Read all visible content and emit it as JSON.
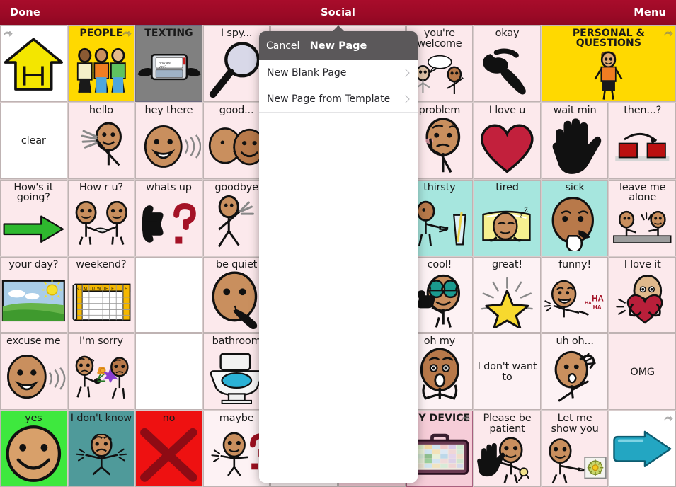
{
  "topbar": {
    "done_label": "Done",
    "title": "Social",
    "menu_label": "Menu",
    "bg_color": "#9e0b28"
  },
  "popover": {
    "cancel_label": "Cancel",
    "title": "New Page",
    "header_color": "#5b585a",
    "rows": [
      {
        "label": "New Blank Page"
      },
      {
        "label": "New Page from Template"
      }
    ]
  },
  "palette": {
    "pink": "#fce9ec",
    "pale_pink": "#fdf2f4",
    "yellow": "#ffd900",
    "gray": "#808080",
    "teal": "#a6e6de",
    "green": "#3ee83e",
    "dark_teal": "#4f9a9a",
    "red": "#ee1111",
    "white": "#ffffff",
    "arrow_teal": "#22a3bf",
    "arrow_green": "#2eb82e",
    "heart_red": "#c2203c"
  },
  "grid": {
    "columns": 10,
    "rows": 6,
    "cells": [
      {
        "id": "home",
        "label": "",
        "art": "house-icon",
        "bg": "#ffffff",
        "link": true,
        "link_side": "left",
        "category": false
      },
      {
        "id": "people",
        "label": "PEOPLE",
        "art": "people-icon",
        "bg": "#ffd900",
        "link": true,
        "category": true
      },
      {
        "id": "texting",
        "label": "TEXTING",
        "art": "texting-icon",
        "bg": "#808080",
        "link": false,
        "category": true
      },
      {
        "id": "i-spy",
        "label": "I spy...",
        "art": "magnifier-icon",
        "bg": "#fce9ec",
        "link": false,
        "category": false
      },
      {
        "id": "hidden-r1c5",
        "label": "",
        "art": "",
        "bg": "#fce9ec",
        "link": false,
        "category": false
      },
      {
        "id": "hidden-r1c6",
        "label": "",
        "art": "",
        "bg": "#fce9ec",
        "link": false,
        "category": false
      },
      {
        "id": "youre-welcome",
        "label": "you're welcome",
        "art": "two-people-talking-icon",
        "bg": "#fce9ec",
        "link": false,
        "category": false
      },
      {
        "id": "okay",
        "label": "okay",
        "art": "ok-hand-icon",
        "bg": "#fce9ec",
        "link": false,
        "category": false
      },
      {
        "id": "personal-questions",
        "label": "PERSONAL & QUESTIONS",
        "art": "boy-icon",
        "bg": "#ffd900",
        "link": true,
        "category": true,
        "span": 2
      },
      {
        "id": "clear",
        "label": "clear",
        "art": "",
        "bg": "#ffffff",
        "link": false,
        "category": false,
        "center": true
      },
      {
        "id": "hello",
        "label": "hello",
        "art": "waving-person-icon",
        "bg": "#fce9ec",
        "link": false,
        "category": false
      },
      {
        "id": "hey-there",
        "label": "hey there",
        "art": "smiling-face-speaking-icon",
        "bg": "#fce9ec",
        "link": false,
        "category": false
      },
      {
        "id": "good",
        "label": "good...",
        "art": "two-faces-icon",
        "bg": "#fce9ec",
        "link": false,
        "category": false
      },
      {
        "id": "hidden-r2c5",
        "label": "",
        "art": "",
        "bg": "#fce9ec",
        "link": false,
        "category": false
      },
      {
        "id": "hidden-r2c6",
        "label": "",
        "art": "",
        "bg": "#fce9ec",
        "link": false,
        "category": false
      },
      {
        "id": "problem",
        "label": "problem",
        "art": "worried-person-icon",
        "bg": "#fce9ec",
        "link": false,
        "category": false
      },
      {
        "id": "i-love-u",
        "label": "I love u",
        "art": "heart-icon",
        "bg": "#fce9ec",
        "link": false,
        "category": false
      },
      {
        "id": "wait-min",
        "label": "wait min",
        "art": "open-hand-icon",
        "bg": "#fce9ec",
        "link": false,
        "category": false
      },
      {
        "id": "then",
        "label": "then...?",
        "art": "sequence-icon",
        "bg": "#fce9ec",
        "link": false,
        "category": false
      },
      {
        "id": "hows-it-going",
        "label": "How's it going?",
        "art": "green-arrow-icon",
        "bg": "#fce9ec",
        "link": false,
        "category": false
      },
      {
        "id": "how-r-u",
        "label": "How r u?",
        "art": "handshake-icon",
        "bg": "#fce9ec",
        "link": false,
        "category": false
      },
      {
        "id": "whats-up",
        "label": "whats up",
        "art": "thumbs-question-icon",
        "bg": "#fce9ec",
        "link": false,
        "category": false
      },
      {
        "id": "goodbye",
        "label": "goodbye",
        "art": "walking-waving-icon",
        "bg": "#fce9ec",
        "link": false,
        "category": false
      },
      {
        "id": "hidden-r3c5",
        "label": "",
        "art": "",
        "bg": "#ffffff",
        "link": false,
        "category": false
      },
      {
        "id": "hidden-r3c6",
        "label": "",
        "art": "",
        "bg": "#a6e6de",
        "link": false,
        "category": false
      },
      {
        "id": "thirsty",
        "label": "thirsty",
        "art": "drinking-glass-icon",
        "bg": "#a6e6de",
        "link": false,
        "category": false
      },
      {
        "id": "tired",
        "label": "tired",
        "art": "sleeping-icon",
        "bg": "#a6e6de",
        "link": false,
        "category": false
      },
      {
        "id": "sick",
        "label": "sick",
        "art": "sick-face-icon",
        "bg": "#a6e6de",
        "link": false,
        "category": false
      },
      {
        "id": "leave-me-alone",
        "label": "leave me alone",
        "art": "two-people-table-icon",
        "bg": "#fce9ec",
        "link": false,
        "category": false
      },
      {
        "id": "your-day",
        "label": "your day?",
        "art": "landscape-icon",
        "bg": "#fce9ec",
        "link": false,
        "category": false
      },
      {
        "id": "weekend",
        "label": "weekend?",
        "art": "calendar-icon",
        "bg": "#fce9ec",
        "link": false,
        "category": false
      },
      {
        "id": "blank-r4c3",
        "label": "",
        "art": "",
        "bg": "#ffffff",
        "link": false,
        "category": false
      },
      {
        "id": "be-quiet",
        "label": "be quiet",
        "art": "quiet-face-icon",
        "bg": "#fce9ec",
        "link": false,
        "category": false
      },
      {
        "id": "hidden-r4c5",
        "label": "",
        "art": "",
        "bg": "#fce9ec",
        "link": false,
        "category": false
      },
      {
        "id": "hidden-r4c6",
        "label": "",
        "art": "",
        "bg": "#fdf2f4",
        "link": false,
        "category": false
      },
      {
        "id": "cool",
        "label": "cool!",
        "art": "sunglasses-icon",
        "bg": "#fdf2f4",
        "link": false,
        "category": false
      },
      {
        "id": "great",
        "label": "great!",
        "art": "star-icon",
        "bg": "#fdf2f4",
        "link": false,
        "category": false
      },
      {
        "id": "funny",
        "label": "funny!",
        "art": "laughing-icon",
        "bg": "#fdf2f4",
        "link": false,
        "category": false
      },
      {
        "id": "i-love-it",
        "label": "I love it",
        "art": "hugging-heart-icon",
        "bg": "#fce9ec",
        "link": false,
        "category": false
      },
      {
        "id": "excuse-me",
        "label": "excuse me",
        "art": "speaking-face-icon",
        "bg": "#fce9ec",
        "link": false,
        "category": false
      },
      {
        "id": "im-sorry",
        "label": "I'm sorry",
        "art": "flowers-apology-icon",
        "bg": "#fce9ec",
        "link": false,
        "category": false
      },
      {
        "id": "blank-r5c3",
        "label": "",
        "art": "",
        "bg": "#ffffff",
        "link": false,
        "category": false
      },
      {
        "id": "bathroom",
        "label": "bathroom",
        "art": "toilet-icon",
        "bg": "#fce9ec",
        "link": false,
        "category": false
      },
      {
        "id": "hidden-r5c5",
        "label": "",
        "art": "",
        "bg": "#fce9ec",
        "link": false,
        "category": false
      },
      {
        "id": "hidden-r5c6",
        "label": "",
        "art": "",
        "bg": "#fdf2f4",
        "link": false,
        "category": false
      },
      {
        "id": "oh-my",
        "label": "oh my",
        "art": "shocked-face-icon",
        "bg": "#fdf2f4",
        "link": false,
        "category": false
      },
      {
        "id": "i-dont-want-to",
        "label": "I don't want to",
        "art": "",
        "bg": "#fdf2f4",
        "link": false,
        "category": false,
        "center": true
      },
      {
        "id": "uh-oh",
        "label": "uh oh...",
        "art": "worried-head-icon",
        "bg": "#fdf2f4",
        "link": false,
        "category": false
      },
      {
        "id": "omg",
        "label": "OMG",
        "art": "",
        "bg": "#fce9ec",
        "link": false,
        "category": false,
        "center": true
      },
      {
        "id": "yes",
        "label": "yes",
        "art": "smiley-icon",
        "bg": "#3ee83e",
        "link": false,
        "category": false
      },
      {
        "id": "i-dont-know",
        "label": "I don't know",
        "art": "shrugging-icon",
        "bg": "#4f9a9a",
        "link": false,
        "category": false
      },
      {
        "id": "no",
        "label": "no",
        "art": "red-x-icon",
        "bg": "#ee1111",
        "link": false,
        "category": false
      },
      {
        "id": "maybe",
        "label": "maybe",
        "art": "question-person-icon",
        "bg": "#fdf2f4",
        "link": false,
        "category": false
      },
      {
        "id": "hidden-r6c5",
        "label": "",
        "art": "",
        "bg": "#fdf2f4",
        "link": false,
        "category": false
      },
      {
        "id": "hidden-r6c6",
        "label": "",
        "art": "",
        "bg": "#f6cdd8",
        "link": false,
        "category": false
      },
      {
        "id": "my-device",
        "label": "MY DEVICE",
        "art": "device-icon",
        "bg": "#f6cdd8",
        "link": true,
        "category": true
      },
      {
        "id": "please-be-patient",
        "label": "Please be patient",
        "art": "patient-person-icon",
        "bg": "#fce9ec",
        "link": false,
        "category": false
      },
      {
        "id": "let-me-show-you",
        "label": "Let me show you",
        "art": "showing-person-icon",
        "bg": "#fce9ec",
        "link": false,
        "category": false
      },
      {
        "id": "next-page",
        "label": "",
        "art": "next-arrow-icon",
        "bg": "#ffffff",
        "link": true,
        "category": false
      }
    ]
  }
}
